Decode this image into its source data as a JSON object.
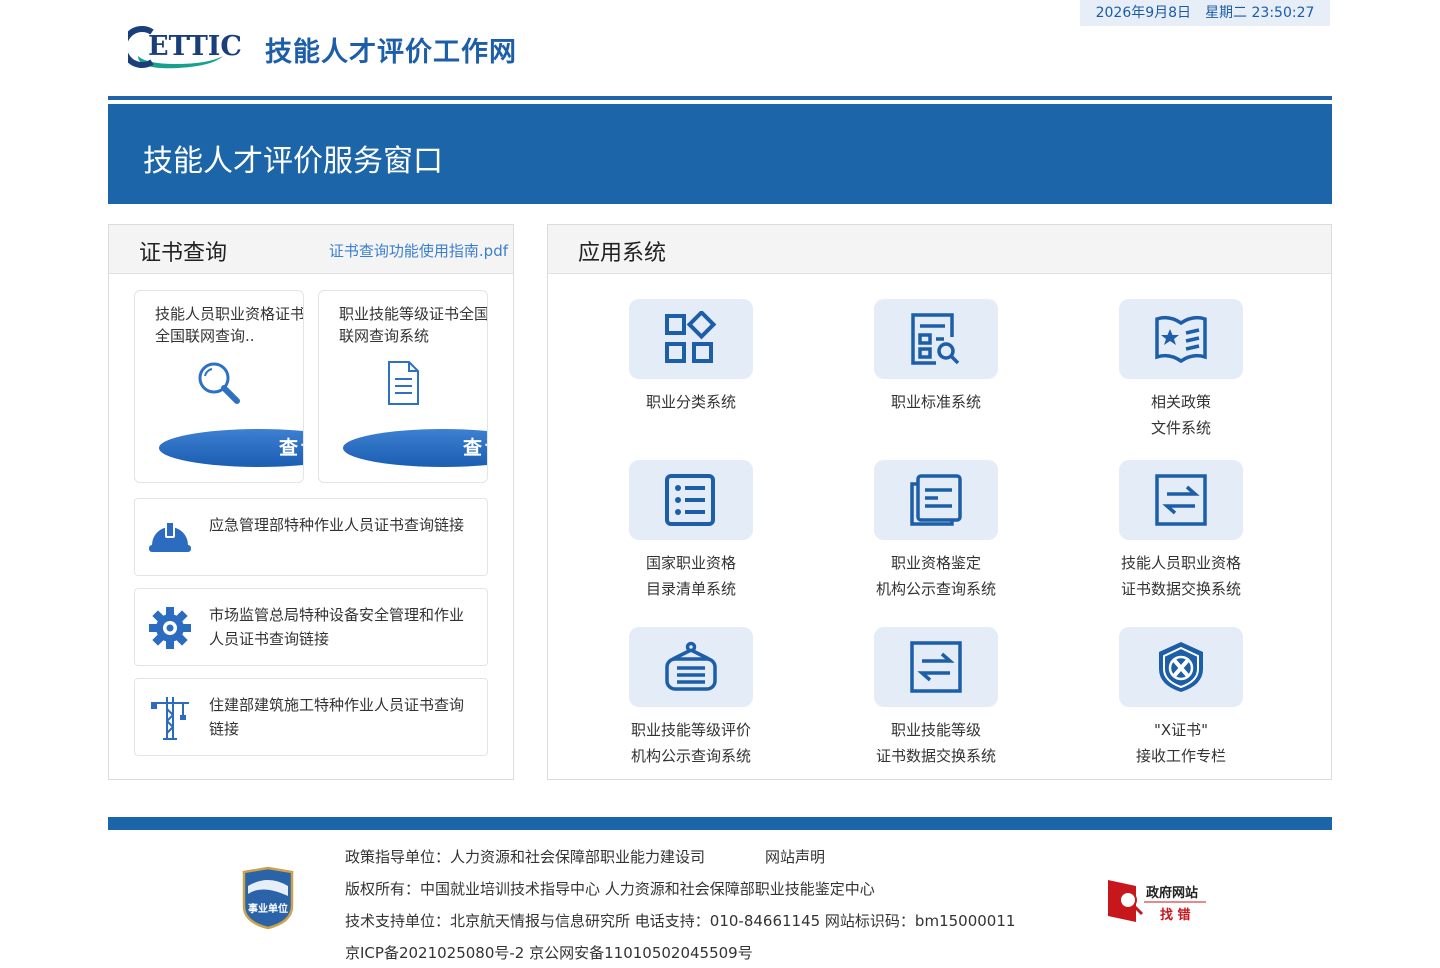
{
  "header": {
    "date": "2026年9月8日",
    "weekday_time": "星期二 23:50:27",
    "logo_text": "ETTIC",
    "site_title": "技能人才评价工作网"
  },
  "banner": {
    "title": "技能人才评价服务窗口"
  },
  "cert_panel": {
    "title": "证书查询",
    "guide_link": "证书查询功能使用指南.pdf",
    "cards": [
      {
        "label": "技能人员职业资格证书全国联网查询..",
        "icon": "search-icon",
        "button": "查询"
      },
      {
        "label": "职业技能等级证书全国联网查询系统",
        "icon": "document-icon",
        "button": "查询"
      }
    ],
    "links": [
      {
        "label": "应急管理部特种作业人员证书查询链接",
        "icon": "hard-hat-icon"
      },
      {
        "label": "市场监管总局特种设备安全管理和作业人员证书查询链接",
        "icon": "gear-icon"
      },
      {
        "label": "住建部建筑施工特种作业人员证书查询链接",
        "icon": "tower-crane-icon"
      }
    ]
  },
  "app_panel": {
    "title": "应用系统",
    "items": [
      {
        "line1": "职业分类系统",
        "line2": "",
        "icon": "category-grid-icon"
      },
      {
        "line1": "职业标准系统",
        "line2": "",
        "icon": "standard-search-icon"
      },
      {
        "line1": "相关政策",
        "line2": "文件系统",
        "icon": "policy-book-icon"
      },
      {
        "line1": "国家职业资格",
        "line2": "目录清单系统",
        "icon": "list-icon"
      },
      {
        "line1": "职业资格鉴定",
        "line2": "机构公示查询系统",
        "icon": "documents-icon"
      },
      {
        "line1": "技能人员职业资格",
        "line2": "证书数据交换系统",
        "icon": "exchange-icon"
      },
      {
        "line1": "职业技能等级评价",
        "line2": "机构公示查询系统",
        "icon": "sign-board-icon"
      },
      {
        "line1": "职业技能等级",
        "line2": "证书数据交换系统",
        "icon": "exchange-icon"
      },
      {
        "line1": "\"X证书\"",
        "line2": "接收工作专栏",
        "icon": "x-shield-icon"
      }
    ]
  },
  "footer": {
    "policy_unit": "政策指导单位：人力资源和社会保障部职业能力建设司",
    "statement": "网站声明",
    "copyright": "版权所有：中国就业培训技术指导中心  人力资源和社会保障部职业技能鉴定中心",
    "support": "技术支持单位：北京航天情报与信息研究所   电话支持：010-84661145   网站标识码：bm15000011",
    "icp": "京ICP备2021025080号-2     京公网安备11010502045509号",
    "badge_text": "事业单位",
    "gov_error_line1": "政府网站",
    "gov_error_line2": "找 错"
  }
}
